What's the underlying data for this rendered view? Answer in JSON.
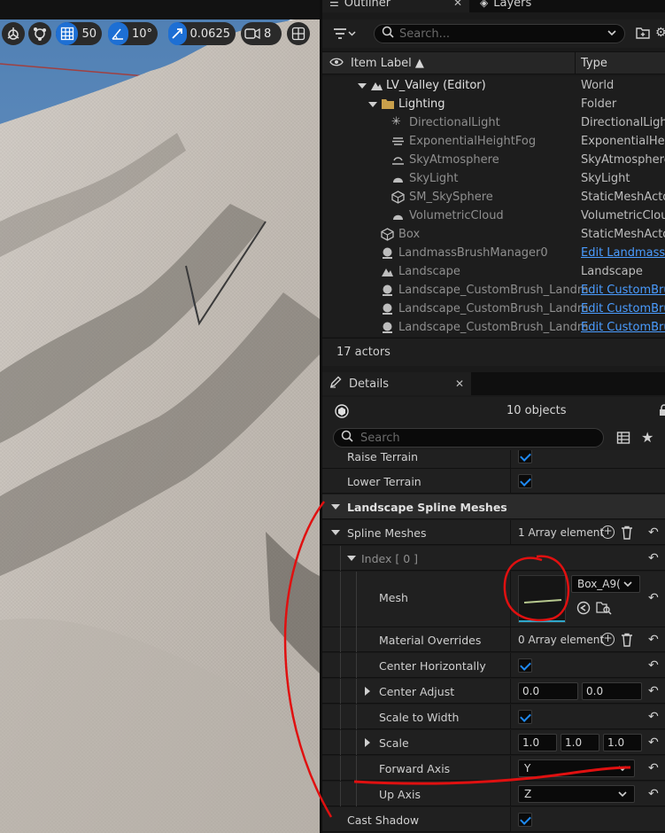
{
  "viewport": {
    "grid_value": "50",
    "angle_value": "10°",
    "scale_value": "0.0625",
    "camera_speed": "8"
  },
  "outliner": {
    "tab_label": "Outliner",
    "layers_tab_label": "Layers",
    "search_placeholder": "Search...",
    "col_label": "Item Label ▲",
    "col_type": "Type",
    "rows": [
      {
        "label": "LV_Valley (Editor)",
        "type": "World",
        "link": false
      },
      {
        "label": "Lighting",
        "type": "Folder",
        "link": false
      },
      {
        "label": "DirectionalLight",
        "type": "DirectionalLight",
        "link": false
      },
      {
        "label": "ExponentialHeightFog",
        "type": "ExponentialHeig",
        "link": false
      },
      {
        "label": "SkyAtmosphere",
        "type": "SkyAtmosphere",
        "link": false
      },
      {
        "label": "SkyLight",
        "type": "SkyLight",
        "link": false
      },
      {
        "label": "SM_SkySphere",
        "type": "StaticMeshActo",
        "link": false
      },
      {
        "label": "VolumetricCloud",
        "type": "VolumetricClou",
        "link": false
      },
      {
        "label": "Box",
        "type": "StaticMeshActo",
        "link": false
      },
      {
        "label": "LandmassBrushManager0",
        "type": "Edit Landmass",
        "link": true
      },
      {
        "label": "Landscape",
        "type": "Landscape",
        "link": false
      },
      {
        "label": "Landscape_CustomBrush_Landm",
        "type": "Edit CustomBru",
        "link": true
      },
      {
        "label": "Landscape_CustomBrush_Landm",
        "type": "Edit CustomBru",
        "link": true
      },
      {
        "label": "Landscape_CustomBrush_Landm",
        "type": "Edit CustomBru",
        "link": true
      }
    ],
    "actor_count": "17 actors"
  },
  "details": {
    "tab_label": "Details",
    "objects_label": "10 objects",
    "search_placeholder": "Search",
    "raise_terrain": "Raise Terrain",
    "lower_terrain": "Lower Terrain",
    "category": "Landscape Spline Meshes",
    "spline_meshes": "Spline Meshes",
    "spline_meshes_value": "1 Array element",
    "index": "Index [ 0 ]",
    "mesh": "Mesh",
    "mesh_value": "Box_A9(",
    "material_overrides": "Material Overrides",
    "material_overrides_value": "0 Array element",
    "center_horizontally": "Center Horizontally",
    "center_adjust": "Center Adjust",
    "center_adjust_x": "0.0",
    "center_adjust_y": "0.0",
    "scale_to_width": "Scale to Width",
    "scale": "Scale",
    "scale_x": "1.0",
    "scale_y": "1.0",
    "scale_z": "1.0",
    "forward_axis": "Forward Axis",
    "forward_axis_value": "Y",
    "up_axis": "Up Axis",
    "up_axis_value": "Z",
    "cast_shadow": "Cast Shadow"
  },
  "colors": {
    "accent": "#1d6fd4",
    "link": "#4a9cff",
    "annotation": "#e01010"
  }
}
